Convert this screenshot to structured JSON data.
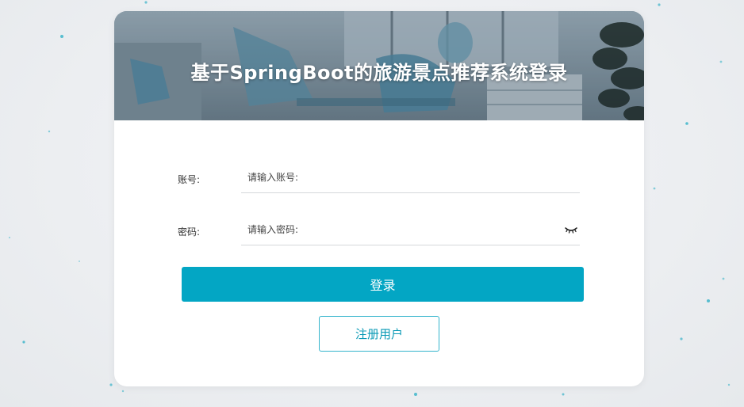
{
  "app": {
    "title": "基于SpringBoot的旅游景点推荐系统登录"
  },
  "form": {
    "account": {
      "label": "账号:",
      "placeholder": "请输入账号:",
      "value": ""
    },
    "password": {
      "label": "密码:",
      "placeholder": "请输入密码:",
      "value": "",
      "toggle_icon": "eye-closed-icon"
    }
  },
  "buttons": {
    "login_label": "登录",
    "register_label": "注册用户"
  },
  "colors": {
    "primary": "#03a6c4",
    "register_border": "#35b5cc",
    "register_text": "#0a9ab6",
    "background": "#eceef1",
    "dot": "#1aa9c2"
  }
}
